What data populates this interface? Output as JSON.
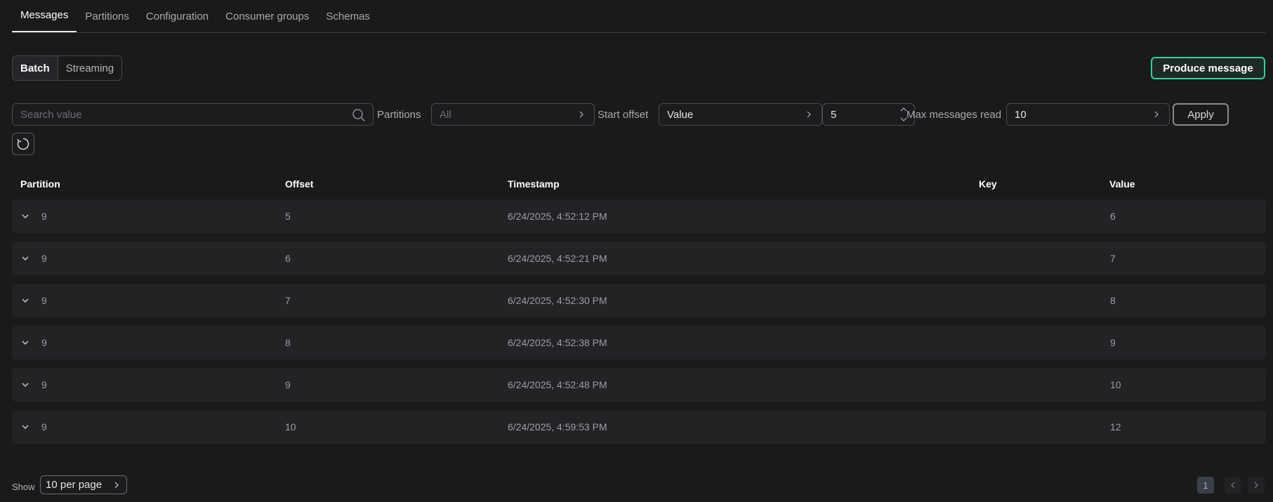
{
  "tabs": [
    {
      "label": "Messages",
      "active": true
    },
    {
      "label": "Partitions"
    },
    {
      "label": "Configuration"
    },
    {
      "label": "Consumer groups"
    },
    {
      "label": "Schemas"
    }
  ],
  "mode": {
    "batch": "Batch",
    "streaming": "Streaming",
    "selected": "Batch"
  },
  "produce_label": "Produce message",
  "filters": {
    "search_placeholder": "Search value",
    "partitions_label": "Partitions",
    "partitions_value": "All",
    "start_offset_label": "Start offset",
    "start_offset_mode": "Value",
    "offset_value": "5",
    "max_messages_label": "Max messages read",
    "max_messages_value": "10",
    "apply_label": "Apply"
  },
  "table": {
    "headers": {
      "partition": "Partition",
      "offset": "Offset",
      "timestamp": "Timestamp",
      "key": "Key",
      "value": "Value"
    },
    "rows": [
      {
        "partition": "9",
        "offset": "5",
        "timestamp": "6/24/2025, 4:52:12 PM",
        "key": "",
        "value": "6"
      },
      {
        "partition": "9",
        "offset": "6",
        "timestamp": "6/24/2025, 4:52:21 PM",
        "key": "",
        "value": "7"
      },
      {
        "partition": "9",
        "offset": "7",
        "timestamp": "6/24/2025, 4:52:30 PM",
        "key": "",
        "value": "8"
      },
      {
        "partition": "9",
        "offset": "8",
        "timestamp": "6/24/2025, 4:52:38 PM",
        "key": "",
        "value": "9"
      },
      {
        "partition": "9",
        "offset": "9",
        "timestamp": "6/24/2025, 4:52:48 PM",
        "key": "",
        "value": "10"
      },
      {
        "partition": "9",
        "offset": "10",
        "timestamp": "6/24/2025, 4:59:53 PM",
        "key": "",
        "value": "12"
      }
    ]
  },
  "footer": {
    "show_label": "Show",
    "per_page": "10 per page",
    "current_page": "1"
  },
  "colors": {
    "accent": "#2dd4a4",
    "background": "#1a1a1b",
    "row": "#232326"
  },
  "icons": {
    "search": "search-icon",
    "refresh": "refresh-icon",
    "expand": "chevron-down-icon"
  }
}
